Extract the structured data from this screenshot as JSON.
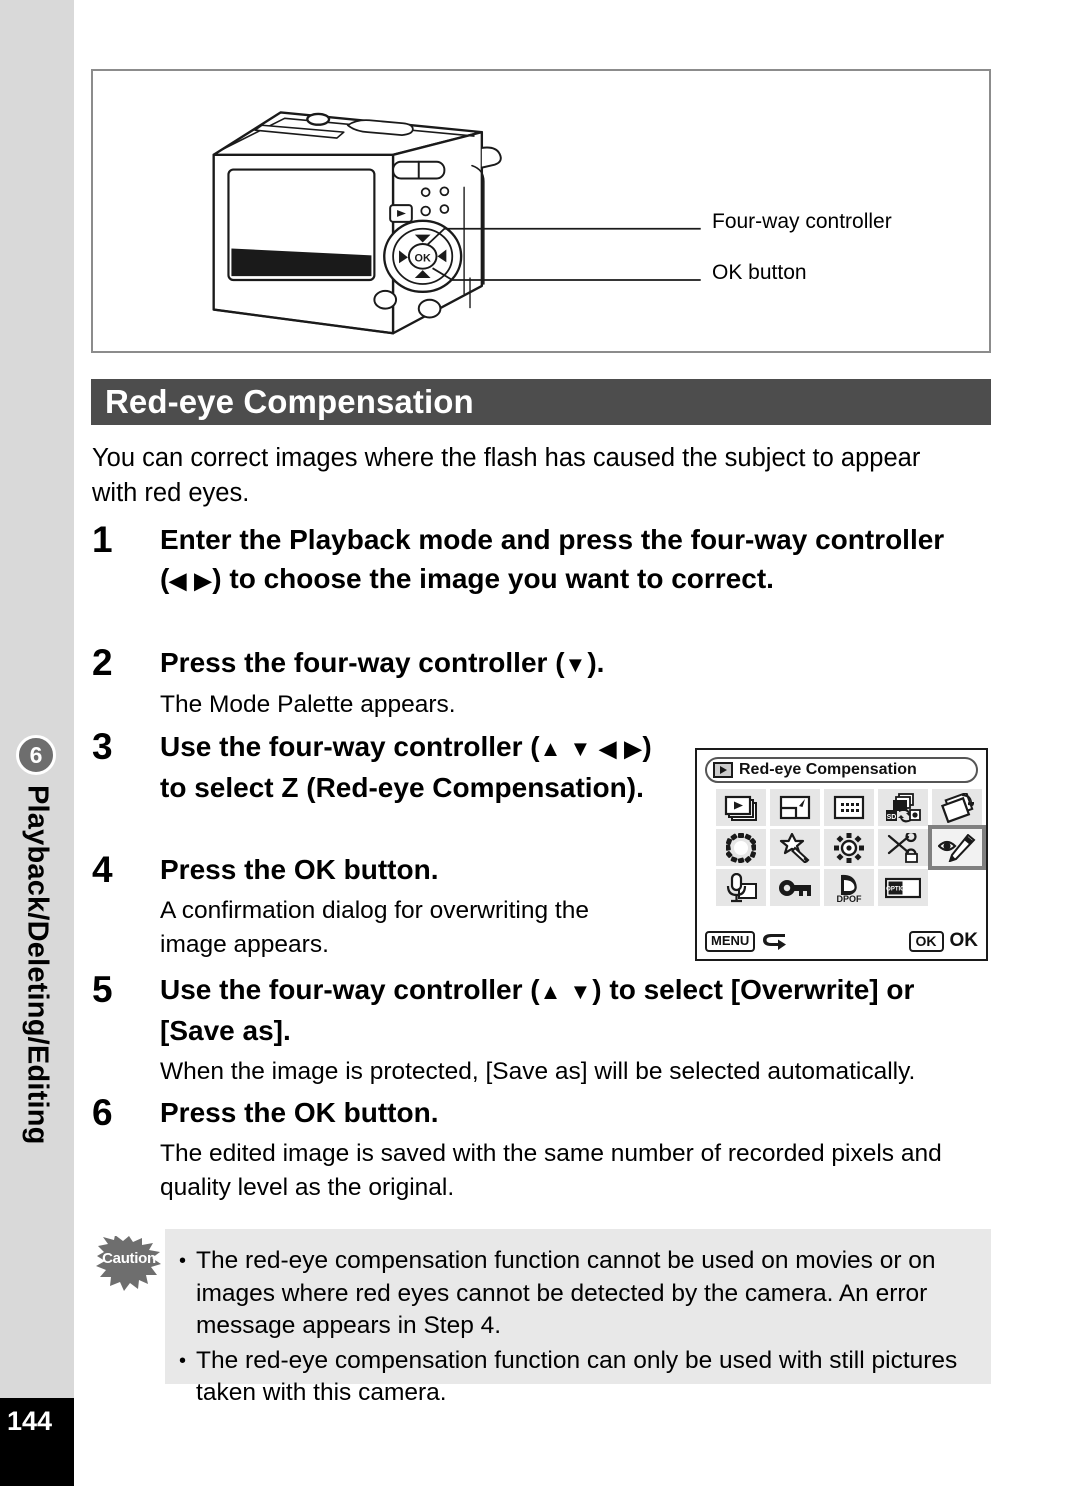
{
  "sidebar": {
    "chapter_number": "6",
    "chapter_title": "Playback/Deleting/Editing",
    "page_number": "144"
  },
  "figure": {
    "callouts": [
      {
        "name": "four-way-controller",
        "label": "Four-way controller"
      },
      {
        "name": "ok-button",
        "label": "OK button"
      }
    ]
  },
  "section": {
    "title": "Red-eye Compensation",
    "intro": "You can correct images where the flash has caused the subject to appear with red eyes."
  },
  "steps": [
    {
      "number": "1",
      "heading_pre": "Enter the Playback mode and press the four-way controller (",
      "arrows": "◀ ▶",
      "heading_post": ") to choose the image you want to correct.",
      "body": ""
    },
    {
      "number": "2",
      "heading_pre": "Press the four-way controller (",
      "arrows": "▼",
      "heading_post": ").",
      "body": "The Mode Palette appears."
    },
    {
      "number": "3",
      "heading_pre": "Use the four-way controller (",
      "arrows": "▲ ▼ ◀ ▶",
      "heading_post": ") to select Z (Red-eye Compensation).",
      "body": ""
    },
    {
      "number": "4",
      "heading_pre": "Press the OK button.",
      "arrows": "",
      "heading_post": "",
      "body": "A confirmation dialog for overwriting the image appears."
    },
    {
      "number": "5",
      "heading_pre": "Use the four-way controller (",
      "arrows": "▲ ▼",
      "heading_post": ") to select [Overwrite] or [Save as].",
      "body": "When the image is protected, [Save as] will be selected automatically."
    },
    {
      "number": "6",
      "heading_pre": "Press the OK button.",
      "arrows": "",
      "heading_post": "",
      "body": "The edited image is saved with the same number of recorded pixels and quality level as the original."
    }
  ],
  "lcd": {
    "title": "Red-eye Compensation",
    "title_icon": "playback-icon",
    "icons": [
      {
        "name": "slideshow-icon",
        "row": 1,
        "selected": false
      },
      {
        "name": "resize-icon",
        "row": 1,
        "selected": false
      },
      {
        "name": "trimming-icon",
        "row": 1,
        "selected": false
      },
      {
        "name": "image-copy-icon",
        "row": 1,
        "selected": false
      },
      {
        "name": "image-rotation-icon",
        "row": 1,
        "selected": false
      },
      {
        "name": "frame-composite-icon",
        "row": 2,
        "selected": false
      },
      {
        "name": "digital-filter-icon",
        "row": 2,
        "selected": false
      },
      {
        "name": "brightness-filter-icon",
        "row": 2,
        "selected": false
      },
      {
        "name": "scissors-edit-icon",
        "row": 2,
        "selected": false
      },
      {
        "name": "red-eye-compensation-icon",
        "row": 2,
        "selected": true
      },
      {
        "name": "voice-memo-icon",
        "row": 3,
        "selected": false
      },
      {
        "name": "protect-key-icon",
        "row": 3,
        "selected": false
      },
      {
        "name": "dpof-icon",
        "row": 3,
        "selected": false
      },
      {
        "name": "start-up-screen-icon",
        "row": 3,
        "selected": false
      }
    ],
    "footer": {
      "menu_key": "MENU",
      "menu_action": "back-arrow-icon",
      "ok_key": "OK",
      "ok_label": "OK"
    },
    "labels": {
      "dpof": "DPOF",
      "optio": "OPTIO"
    }
  },
  "caution": {
    "icon_label": "Caution",
    "items": [
      "The red-eye compensation function cannot be used on movies or on images where red eyes cannot be detected by the camera. An error message appears in Step 4.",
      "The red-eye compensation function can only be used with still pictures taken with this camera."
    ]
  },
  "colors": {
    "title_bar": "#4d4d4d",
    "sidebar": "#d9d9d9",
    "caution_bg": "#e8e8e8",
    "selection_outline": "#808080"
  }
}
